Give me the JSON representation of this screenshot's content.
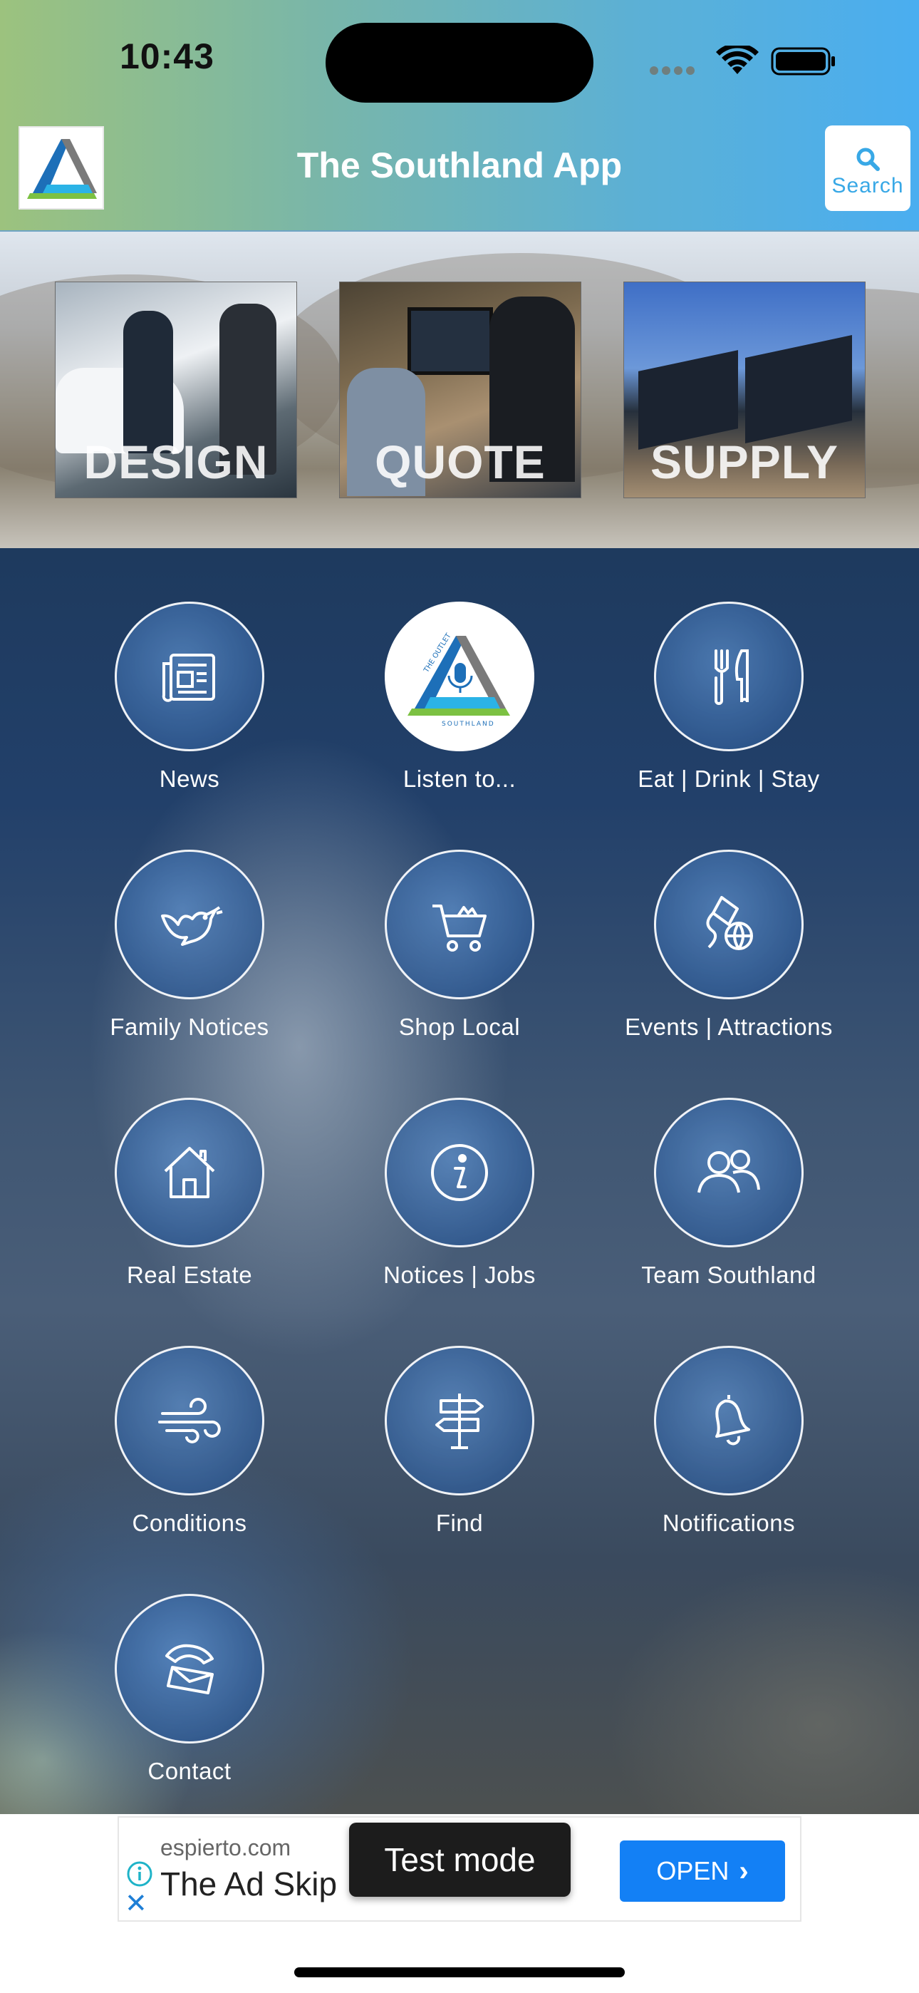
{
  "status_bar": {
    "time": "10:43"
  },
  "header": {
    "title": "The Southland App",
    "search_label": "Search",
    "colors": {
      "gradient_start": "#9cc27e",
      "gradient_end": "#4aaef0"
    }
  },
  "banner": {
    "cards": [
      {
        "label": "DESIGN"
      },
      {
        "label": "QUOTE"
      },
      {
        "label": "SUPPLY"
      }
    ]
  },
  "grid": {
    "tiles": [
      {
        "label": "News",
        "icon": "newspaper-icon"
      },
      {
        "label": "Listen to...",
        "icon": "podcast-logo-icon"
      },
      {
        "label": "Eat | Drink | Stay",
        "icon": "fork-knife-icon"
      },
      {
        "label": "Family Notices",
        "icon": "dove-icon"
      },
      {
        "label": "Shop Local",
        "icon": "shopping-cart-icon"
      },
      {
        "label": "Events | Attractions",
        "icon": "kite-ball-icon"
      },
      {
        "label": "Real Estate",
        "icon": "house-icon"
      },
      {
        "label": "Notices | Jobs",
        "icon": "info-icon"
      },
      {
        "label": "Team Southland",
        "icon": "people-icon"
      },
      {
        "label": "Conditions",
        "icon": "wind-icon"
      },
      {
        "label": "Find",
        "icon": "signpost-icon"
      },
      {
        "label": "Notifications",
        "icon": "bell-icon"
      },
      {
        "label": "Contact",
        "icon": "phone-mail-icon"
      }
    ]
  },
  "podcast_logo_text": {
    "top": "THE OUTLET",
    "bottom": "SOUTHLAND"
  },
  "ad": {
    "domain": "espierto.com",
    "title": "The Ad Skip",
    "open_label": "OPEN",
    "test_mode": "Test mode",
    "button_color": "#1380f5"
  }
}
